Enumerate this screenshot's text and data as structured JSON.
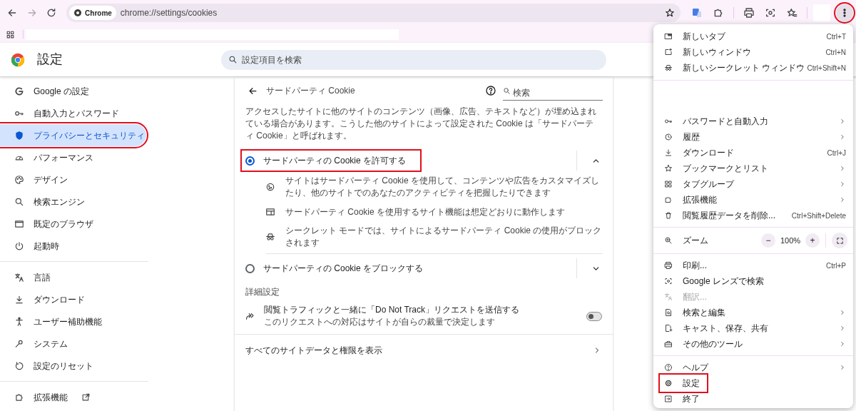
{
  "toolbar": {
    "site_chip": "Chrome",
    "url": "chrome://settings/cookies",
    "menu_button": {
      "highlighted": true
    }
  },
  "settings_header": {
    "title": "設定",
    "search_placeholder": "設定項目を検索"
  },
  "sidebar": {
    "groups": [
      [
        {
          "label": "Google の設定",
          "selected": false,
          "highlighted": false,
          "external": false
        },
        {
          "label": "自動入力とパスワード",
          "selected": false,
          "highlighted": false,
          "external": false
        },
        {
          "label": "プライバシーとセキュリティ",
          "selected": true,
          "highlighted": true,
          "external": false
        },
        {
          "label": "パフォーマンス",
          "selected": false,
          "highlighted": false,
          "external": false
        },
        {
          "label": "デザイン",
          "selected": false,
          "highlighted": false,
          "external": false
        },
        {
          "label": "検索エンジン",
          "selected": false,
          "highlighted": false,
          "external": false
        },
        {
          "label": "既定のブラウザ",
          "selected": false,
          "highlighted": false,
          "external": false
        },
        {
          "label": "起動時",
          "selected": false,
          "highlighted": false,
          "external": false
        }
      ],
      [
        {
          "label": "言語",
          "selected": false,
          "highlighted": false,
          "external": false
        },
        {
          "label": "ダウンロード",
          "selected": false,
          "highlighted": false,
          "external": false
        },
        {
          "label": "ユーザー補助機能",
          "selected": false,
          "highlighted": false,
          "external": false
        },
        {
          "label": "システム",
          "selected": false,
          "highlighted": false,
          "external": false
        },
        {
          "label": "設定のリセット",
          "selected": false,
          "highlighted": false,
          "external": false
        }
      ],
      [
        {
          "label": "拡張機能",
          "selected": false,
          "highlighted": false,
          "external": true
        }
      ]
    ]
  },
  "page": {
    "title": "サードパーティ Cookie",
    "search_placeholder": "検索",
    "description": "アクセスしたサイトに他のサイトのコンテンツ（画像、広告、テキストなど）が埋め込まれている場合があります。こうした他のサイトによって設定された Cookie は「サードパーティ Cookie」と呼ばれます。",
    "options": [
      {
        "label": "サードパーティの Cookie を許可する",
        "selected": true,
        "expanded": true,
        "highlighted": true,
        "details": [
          "サイトはサードパーティ Cookie を使用して、コンテンツや広告をカスタマイズしたり、他のサイトでのあなたのアクティビティを把握したりできます",
          "サードパーティ Cookie を使用するサイト機能は想定どおりに動作します",
          "シークレット モードでは、サイトによるサードパーティ Cookie の使用がブロックされます"
        ]
      },
      {
        "label": "サードパーティの Cookie をブロックする",
        "selected": false,
        "expanded": false,
        "highlighted": false
      }
    ],
    "section_heading": "詳細設定",
    "do_not_track": {
      "title": "閲覧トラフィックと一緒に「Do Not Track」リクエストを送信する",
      "subtitle": "このリクエストへの対応はサイトが自らの裁量で決定します",
      "on": false
    },
    "link": "すべてのサイトデータと権限を表示"
  },
  "menu": {
    "sections": [
      [
        {
          "kind": "item",
          "label": "新しいタブ",
          "shortcut": "Ctrl+T",
          "submenu": false,
          "disabled": false,
          "highlighted": false
        },
        {
          "kind": "item",
          "label": "新しいウィンドウ",
          "shortcut": "Ctrl+N",
          "submenu": false,
          "disabled": false,
          "highlighted": false
        },
        {
          "kind": "item",
          "label": "新しいシークレット ウィンドウ",
          "shortcut": "Ctrl+Shift+N",
          "submenu": false,
          "disabled": false,
          "highlighted": false
        }
      ],
      [
        {
          "kind": "item",
          "label": "パスワードと自動入力",
          "submenu": true,
          "disabled": false,
          "highlighted": false
        },
        {
          "kind": "item",
          "label": "履歴",
          "submenu": true,
          "disabled": false,
          "highlighted": false
        },
        {
          "kind": "item",
          "label": "ダウンロード",
          "shortcut": "Ctrl+J",
          "submenu": false,
          "disabled": false,
          "highlighted": false
        },
        {
          "kind": "item",
          "label": "ブックマークとリスト",
          "submenu": true,
          "disabled": false,
          "highlighted": false
        },
        {
          "kind": "item",
          "label": "タブグループ",
          "submenu": true,
          "disabled": false,
          "highlighted": false
        },
        {
          "kind": "item",
          "label": "拡張機能",
          "submenu": true,
          "disabled": false,
          "highlighted": false
        },
        {
          "kind": "item",
          "label": "閲覧履歴データを削除...",
          "shortcut": "Ctrl+Shift+Delete",
          "submenu": false,
          "disabled": false,
          "highlighted": false
        }
      ],
      [
        {
          "kind": "zoom",
          "label": "ズーム",
          "minus": "−",
          "value": "100%",
          "plus": "+"
        }
      ],
      [
        {
          "kind": "item",
          "label": "印刷...",
          "shortcut": "Ctrl+P",
          "submenu": false,
          "disabled": false,
          "highlighted": false
        },
        {
          "kind": "item",
          "label": "Google レンズで検索",
          "submenu": false,
          "disabled": false,
          "highlighted": false
        },
        {
          "kind": "item",
          "label": "翻訳...",
          "submenu": false,
          "disabled": true,
          "highlighted": false
        },
        {
          "kind": "item",
          "label": "検索と編集",
          "submenu": true,
          "disabled": false,
          "highlighted": false
        },
        {
          "kind": "item",
          "label": "キャスト、保存、共有",
          "submenu": true,
          "disabled": false,
          "highlighted": false
        },
        {
          "kind": "item",
          "label": "その他のツール",
          "submenu": true,
          "disabled": false,
          "highlighted": false
        }
      ],
      [
        {
          "kind": "item",
          "label": "ヘルプ",
          "submenu": true,
          "disabled": false,
          "highlighted": false
        },
        {
          "kind": "item",
          "label": "設定",
          "submenu": false,
          "disabled": false,
          "highlighted": true
        },
        {
          "kind": "item",
          "label": "終了",
          "submenu": false,
          "disabled": false,
          "highlighted": false
        }
      ]
    ]
  }
}
